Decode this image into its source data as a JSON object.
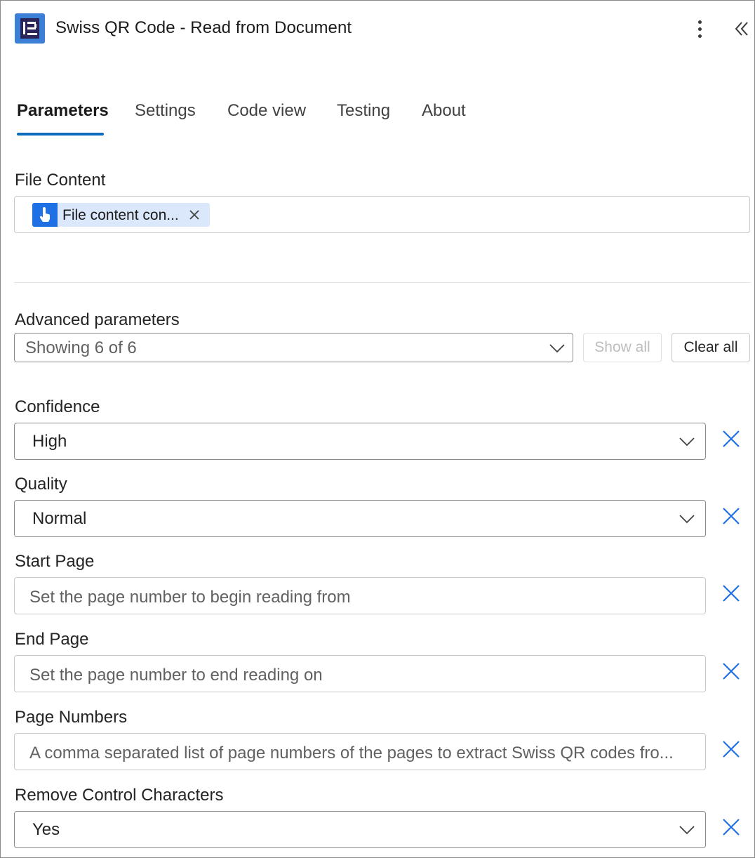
{
  "header": {
    "title": "Swiss QR Code - Read from Document",
    "app_icon": "plugin-logo-icon",
    "more_icon": "more-vertical-icon",
    "collapse_icon": "double-chevron-left-icon"
  },
  "tabs": [
    {
      "label": "Parameters",
      "active": true
    },
    {
      "label": "Settings",
      "active": false
    },
    {
      "label": "Code view",
      "active": false
    },
    {
      "label": "Testing",
      "active": false
    },
    {
      "label": "About",
      "active": false
    }
  ],
  "file_content": {
    "label": "File Content",
    "token_text": "File content con...",
    "token_icon": "hand-pointer-icon"
  },
  "advanced": {
    "label": "Advanced parameters",
    "selected": "Showing 6 of 6",
    "show_all": "Show all",
    "clear_all": "Clear all"
  },
  "params": {
    "confidence": {
      "label": "Confidence",
      "value": "High"
    },
    "quality": {
      "label": "Quality",
      "value": "Normal"
    },
    "start_page": {
      "label": "Start Page",
      "placeholder": "Set the page number to begin reading from"
    },
    "end_page": {
      "label": "End Page",
      "placeholder": "Set the page number to end reading on"
    },
    "page_numbers": {
      "label": "Page Numbers",
      "placeholder": "A comma separated list of page numbers of the pages to extract Swiss QR codes fro..."
    },
    "remove_control": {
      "label": "Remove Control Characters",
      "value": "Yes"
    }
  },
  "colors": {
    "accent": "#0f6cbd",
    "remove_x": "#1f6fe5",
    "token_bg": "#dbe8fb"
  }
}
